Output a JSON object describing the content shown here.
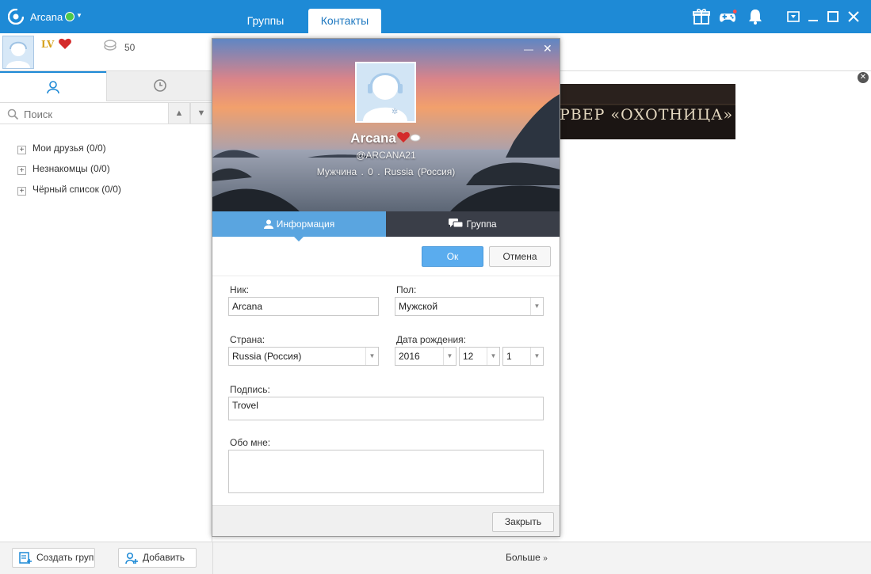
{
  "app": {
    "name": "Arcana",
    "tabs": [
      {
        "label": "Группы"
      },
      {
        "label": "Контакты"
      }
    ]
  },
  "profile_strip": {
    "level_badge": "LV",
    "coins": "50"
  },
  "sidebar": {
    "search_placeholder": "Поиск",
    "groups": [
      {
        "label": "Мои друзья (0/0)"
      },
      {
        "label": "Незнакомцы (0/0)"
      },
      {
        "label": "Чёрный список (0/0)"
      }
    ]
  },
  "banner": {
    "text": "РВЕР «ОХОТНИЦА»"
  },
  "bottom": {
    "create_group_label": "Создать груп",
    "add_label": "Добавить",
    "more_label": "Больше"
  },
  "dialog": {
    "name": "Arcana",
    "handle": "@ARCANA21",
    "meta": "Мужчина . 0 . Russia (Россия)",
    "tabs": [
      {
        "label": "Информация"
      },
      {
        "label": "Группа"
      }
    ],
    "ok_label": "Ок",
    "cancel_label": "Отмена",
    "close_label": "Закрыть",
    "form": {
      "nick_label": "Ник:",
      "nick_value": "Arcana",
      "gender_label": "Пол:",
      "gender_value": "Мужской",
      "country_label": "Страна:",
      "country_value": "Russia (Россия)",
      "birthdate_label": "Дата рождения:",
      "birth_year": "2016",
      "birth_month": "12",
      "birth_day": "1",
      "signature_label": "Подпись:",
      "signature_value": "Trovel",
      "about_label": "Обо мне:",
      "about_value": ""
    }
  },
  "colors": {
    "titlebar": "#1e8ad6",
    "accent_tab": "#5aa5e0",
    "ok_button": "#5aacee",
    "dark_tab": "#3a3e48"
  },
  "icons": {
    "logo": "app-logo-icon",
    "gift": "gift-icon",
    "gamepad": "gamepad-icon",
    "bell": "bell-icon",
    "user": "user-icon",
    "clock": "clock-icon",
    "search": "search-icon",
    "chat": "chat-bubbles-icon"
  }
}
